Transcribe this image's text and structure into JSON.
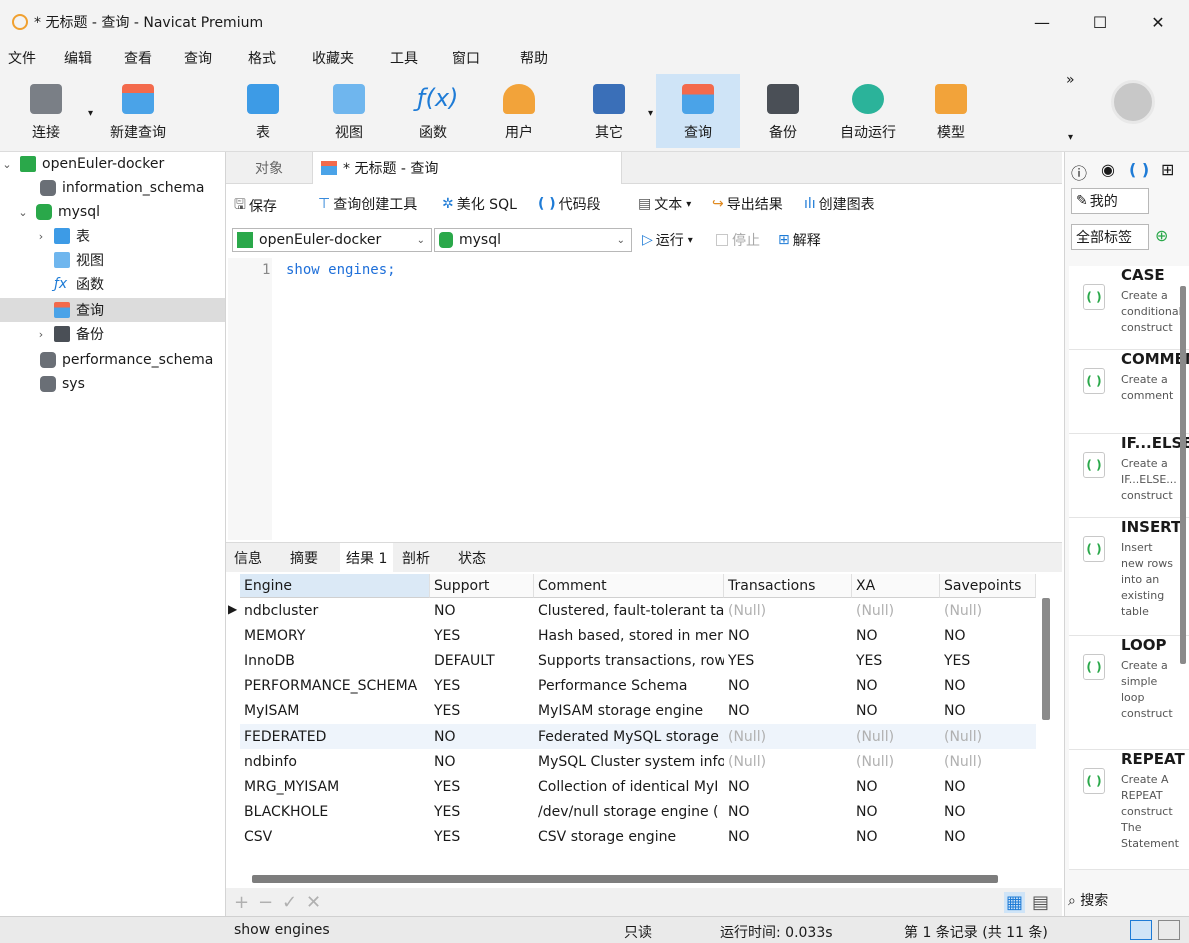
{
  "window": {
    "title": "* 无标题 - 查询 - Navicat Premium",
    "minimize": "—",
    "maximize": "☐",
    "close": "✕"
  },
  "menu": [
    "文件",
    "编辑",
    "查看",
    "查询",
    "格式",
    "收藏夹",
    "工具",
    "窗口",
    "帮助"
  ],
  "toolbar": {
    "connect": "连接",
    "new_query": "新建查询",
    "table": "表",
    "view": "视图",
    "function": "函数",
    "user": "用户",
    "other": "其它",
    "query": "查询",
    "backup": "备份",
    "automation": "自动运行",
    "model": "模型",
    "overflow": "»"
  },
  "sidebar": {
    "connection": "openEuler-docker",
    "db_information_schema": "information_schema",
    "db_mysql": "mysql",
    "node_table": "表",
    "node_view": "视图",
    "node_function": "函数",
    "node_query": "查询",
    "node_backup": "备份",
    "db_performance_schema": "performance_schema",
    "db_sys": "sys"
  },
  "tabs": {
    "objects": "对象",
    "query_tab": "* 无标题 - 查询"
  },
  "query_toolbar": {
    "save": "保存",
    "query_builder": "查询创建工具",
    "beautify": "美化 SQL",
    "snippet": "代码段",
    "text": "文本",
    "export": "导出结果",
    "chart": "创建图表"
  },
  "connbar": {
    "connection": "openEuler-docker",
    "database": "mysql",
    "run": "运行",
    "stop": "停止",
    "explain": "解释"
  },
  "editor": {
    "line": "1",
    "code": "show engines;"
  },
  "result_tabs": [
    "信息",
    "摘要",
    "结果 1",
    "剖析",
    "状态"
  ],
  "grid": {
    "columns": [
      "Engine",
      "Support",
      "Comment",
      "Transactions",
      "XA",
      "Savepoints"
    ],
    "rows": [
      [
        "ndbcluster",
        "NO",
        "Clustered, fault-tolerant ta",
        "(Null)",
        "(Null)",
        "(Null)"
      ],
      [
        "MEMORY",
        "YES",
        "Hash based, stored in mer",
        "NO",
        "NO",
        "NO"
      ],
      [
        "InnoDB",
        "DEFAULT",
        "Supports transactions, row",
        "YES",
        "YES",
        "YES"
      ],
      [
        "PERFORMANCE_SCHEMA",
        "YES",
        "Performance Schema",
        "NO",
        "NO",
        "NO"
      ],
      [
        "MyISAM",
        "YES",
        "MyISAM storage engine",
        "NO",
        "NO",
        "NO"
      ],
      [
        "FEDERATED",
        "NO",
        "Federated MySQL storage",
        "(Null)",
        "(Null)",
        "(Null)"
      ],
      [
        "ndbinfo",
        "NO",
        "MySQL Cluster system info",
        "(Null)",
        "(Null)",
        "(Null)"
      ],
      [
        "MRG_MYISAM",
        "YES",
        "Collection of identical MyI",
        "NO",
        "NO",
        "NO"
      ],
      [
        "BLACKHOLE",
        "YES",
        "/dev/null storage engine (",
        "NO",
        "NO",
        "NO"
      ],
      [
        "CSV",
        "YES",
        "CSV storage engine",
        "NO",
        "NO",
        "NO"
      ]
    ]
  },
  "status": {
    "sql": "show engines",
    "readonly": "只读",
    "time": "运行时间: 0.033s",
    "record": "第 1 条记录 (共 11 条)"
  },
  "right_panel": {
    "filter_mine": "我的",
    "filter_all": "全部标签",
    "search": "搜索",
    "snippets": [
      {
        "title": "CASE",
        "desc": "Create a\nconditional\nconstruct"
      },
      {
        "title": "COMMENT",
        "desc": "Create a\ncomment"
      },
      {
        "title": "IF...ELSE",
        "desc": "Create a\nIF...ELSE...\nconstruct"
      },
      {
        "title": "INSERT",
        "desc": "Insert\nnew rows\ninto an\nexisting\ntable"
      },
      {
        "title": "LOOP",
        "desc": "Create a\nsimple\nloop\nconstruct"
      },
      {
        "title": "REPEAT",
        "desc": "Create A\nREPEAT\nconstruct\nThe\nStatement\nlist is"
      }
    ]
  },
  "colors": {
    "accent": "#1e7bd6",
    "active_tool": "#cfe4f7",
    "selected_row": "#dcdcdc",
    "null_text": "#b0b0b0",
    "db_green": "#2aa84a"
  }
}
